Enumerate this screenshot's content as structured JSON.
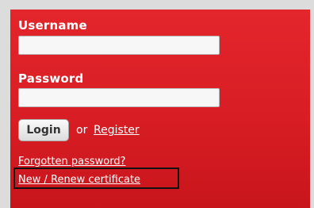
{
  "form": {
    "username_label": "Username",
    "username_value": "",
    "password_label": "Password",
    "password_value": "",
    "login_label": "Login",
    "or_text": "or",
    "register_label": "Register",
    "forgot_label": "Forgotten password?",
    "renew_label": "New / Renew certificate"
  },
  "colors": {
    "panel_red": "#d81d24",
    "background_gray": "#dcdcdc",
    "highlight_border": "#111111"
  }
}
